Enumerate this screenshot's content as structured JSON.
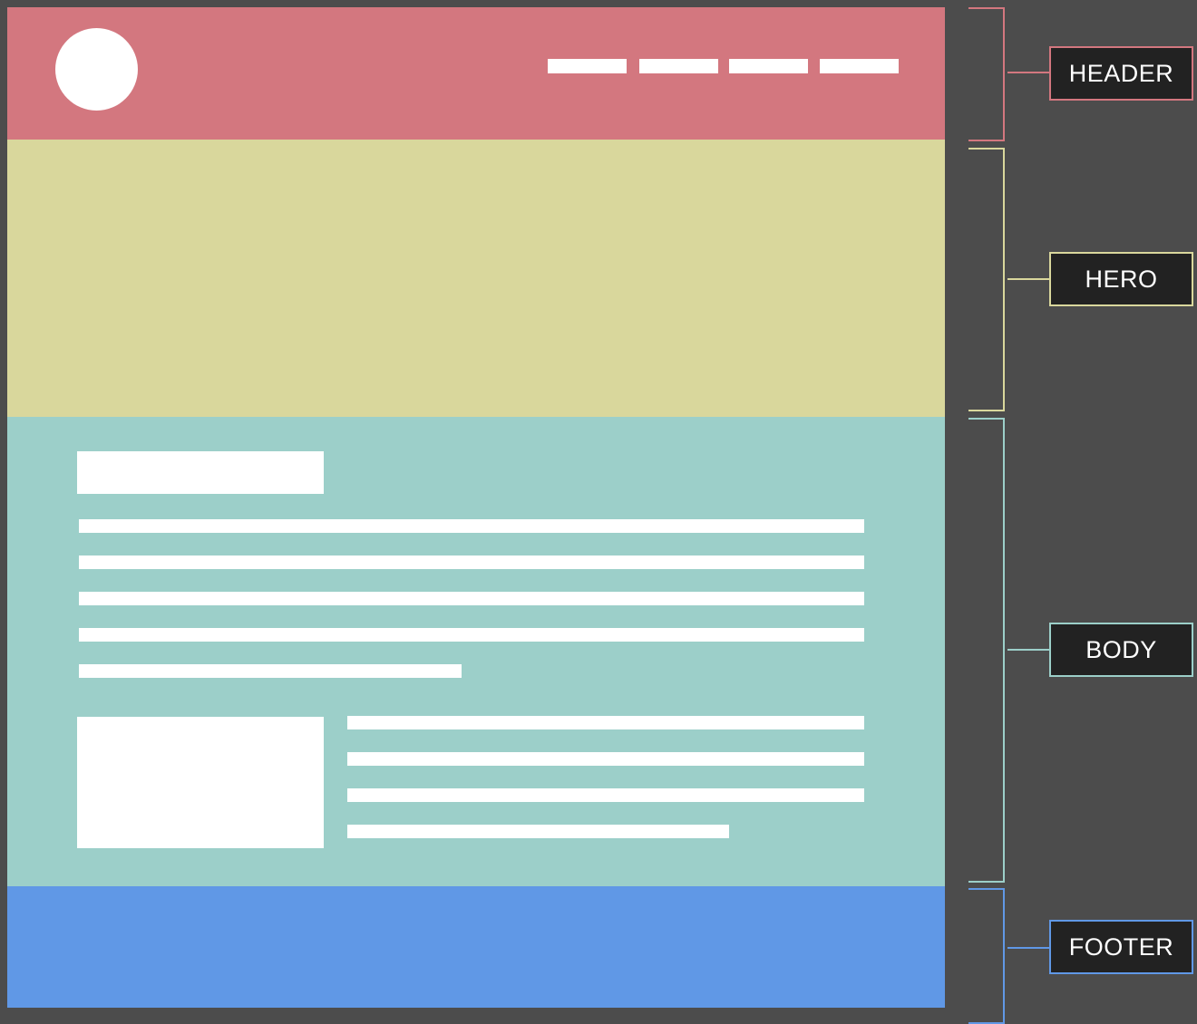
{
  "colors": {
    "background": "#4c4c4c",
    "header": "#d3777f",
    "hero": "#d9d79c",
    "body": "#9ccfc9",
    "footer": "#6098e6",
    "placeholder": "#ffffff",
    "label_box": "#222222"
  },
  "wireframe": {
    "header": {
      "nav_item_count": 4,
      "has_logo": true
    },
    "body": {
      "paragraph_line_count": 5,
      "media_text_line_count": 4
    }
  },
  "labels": {
    "header": "HEADER",
    "hero": "HERO",
    "body": "BODY",
    "footer": "FOOTER"
  }
}
